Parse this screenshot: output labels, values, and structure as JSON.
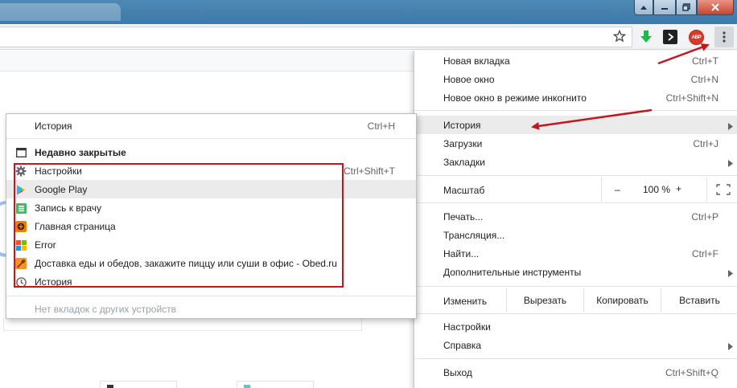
{
  "window": {
    "controls": {
      "help": "help-icon",
      "minimize": "minimize-icon",
      "maximize": "maximize-icon",
      "close": "close-icon"
    }
  },
  "toolbar": {
    "abp_label": "ABP",
    "icons": [
      "star-icon",
      "download-arrow-icon",
      "command-icon",
      "adblock-icon",
      "kebab-menu-icon"
    ]
  },
  "main_menu": {
    "new_tab": {
      "label": "Новая вкладка",
      "shortcut": "Ctrl+T"
    },
    "new_window": {
      "label": "Новое окно",
      "shortcut": "Ctrl+N"
    },
    "incognito": {
      "label": "Новое окно в режиме инкогнито",
      "shortcut": "Ctrl+Shift+N"
    },
    "history": {
      "label": "История"
    },
    "downloads": {
      "label": "Загрузки",
      "shortcut": "Ctrl+J"
    },
    "bookmarks": {
      "label": "Закладки"
    },
    "zoom": {
      "label": "Масштаб",
      "minus": "–",
      "value": "100 %",
      "plus": "+"
    },
    "print": {
      "label": "Печать...",
      "shortcut": "Ctrl+P"
    },
    "cast": {
      "label": "Трансляция..."
    },
    "find": {
      "label": "Найти...",
      "shortcut": "Ctrl+F"
    },
    "more_tools": {
      "label": "Дополнительные инструменты"
    },
    "edit": {
      "label": "Изменить",
      "cut": "Вырезать",
      "copy": "Копировать",
      "paste": "Вставить"
    },
    "settings": {
      "label": "Настройки"
    },
    "help": {
      "label": "Справка"
    },
    "exit": {
      "label": "Выход",
      "shortcut": "Ctrl+Shift+Q"
    }
  },
  "history_submenu": {
    "history": {
      "label": "История",
      "shortcut": "Ctrl+H"
    },
    "recently_closed": {
      "label": "Недавно закрытые"
    },
    "items": [
      {
        "label": "Настройки",
        "shortcut": "Ctrl+Shift+T",
        "icon": "gear-icon"
      },
      {
        "label": "Google Play",
        "icon": "google-play-icon"
      },
      {
        "label": "Запись к врачу",
        "icon": "green-doc-icon"
      },
      {
        "label": "Главная страница",
        "icon": "orange-site-icon"
      },
      {
        "label": "Error",
        "icon": "windows-logo-icon"
      },
      {
        "label": "Доставка еды и обедов, закажите пиццу или суши в офис - Obed.ru",
        "icon": "obed-spoon-icon"
      },
      {
        "label": "История",
        "icon": "clock-icon"
      }
    ],
    "no_tabs": {
      "label": "Нет вкладок с других устройств"
    }
  },
  "colors": {
    "annotation_red": "#c4161c",
    "highlight": "#ebebeb",
    "titlebar": "#3c7aa9"
  }
}
